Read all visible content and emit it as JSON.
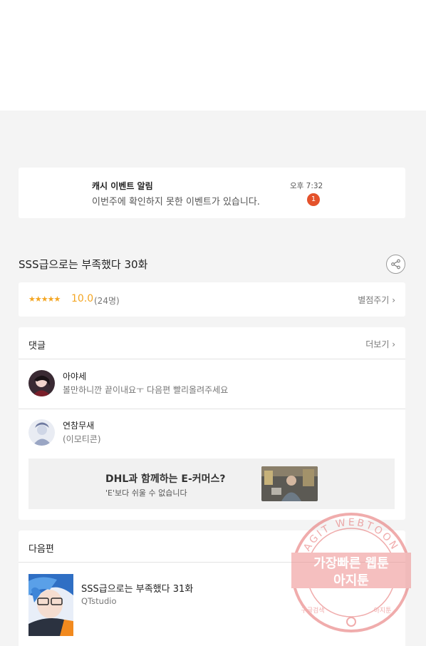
{
  "notification": {
    "title": "캐시 이벤트 알림",
    "message": "이번주에 확인하지 못한 이벤트가 있습니다.",
    "time": "오후 7:32",
    "badge_count": "1"
  },
  "episode": {
    "title": "SSS급으로는 부족했다 30화",
    "share_icon": "share-icon"
  },
  "rating": {
    "stars": "★★★★★",
    "score": "10.0",
    "votes": "(24명)",
    "rate_label": "별점주기",
    "rate_chevron": "›"
  },
  "comments": {
    "title": "댓글",
    "more_label": "더보기",
    "more_chevron": "›",
    "items": [
      {
        "author": "아야세",
        "text": "볼만하니깐 끝이내요ㅜ 다음편 빨리올려주세요"
      },
      {
        "author": "연참무새",
        "text": "(이모티콘)"
      }
    ]
  },
  "ad": {
    "title": "DHL과 함께하는 E-커머스?",
    "subtitle": "'E'보다 쉬울 수 없습니다"
  },
  "next_episode": {
    "section_title": "다음편",
    "title": "SSS급으로는 부족했다 31화",
    "studio": "QTstudio"
  },
  "watermark": {
    "ring_text": "AGIT WEBTOON",
    "line1": "가장빠른 웹툰",
    "line2": "아지툰",
    "bottom_left": "구글검색",
    "bottom_right": "아지툰"
  },
  "colors": {
    "accent_orange": "#f4a623",
    "badge_red": "#e4522b",
    "watermark_red": "#e46a6a"
  }
}
